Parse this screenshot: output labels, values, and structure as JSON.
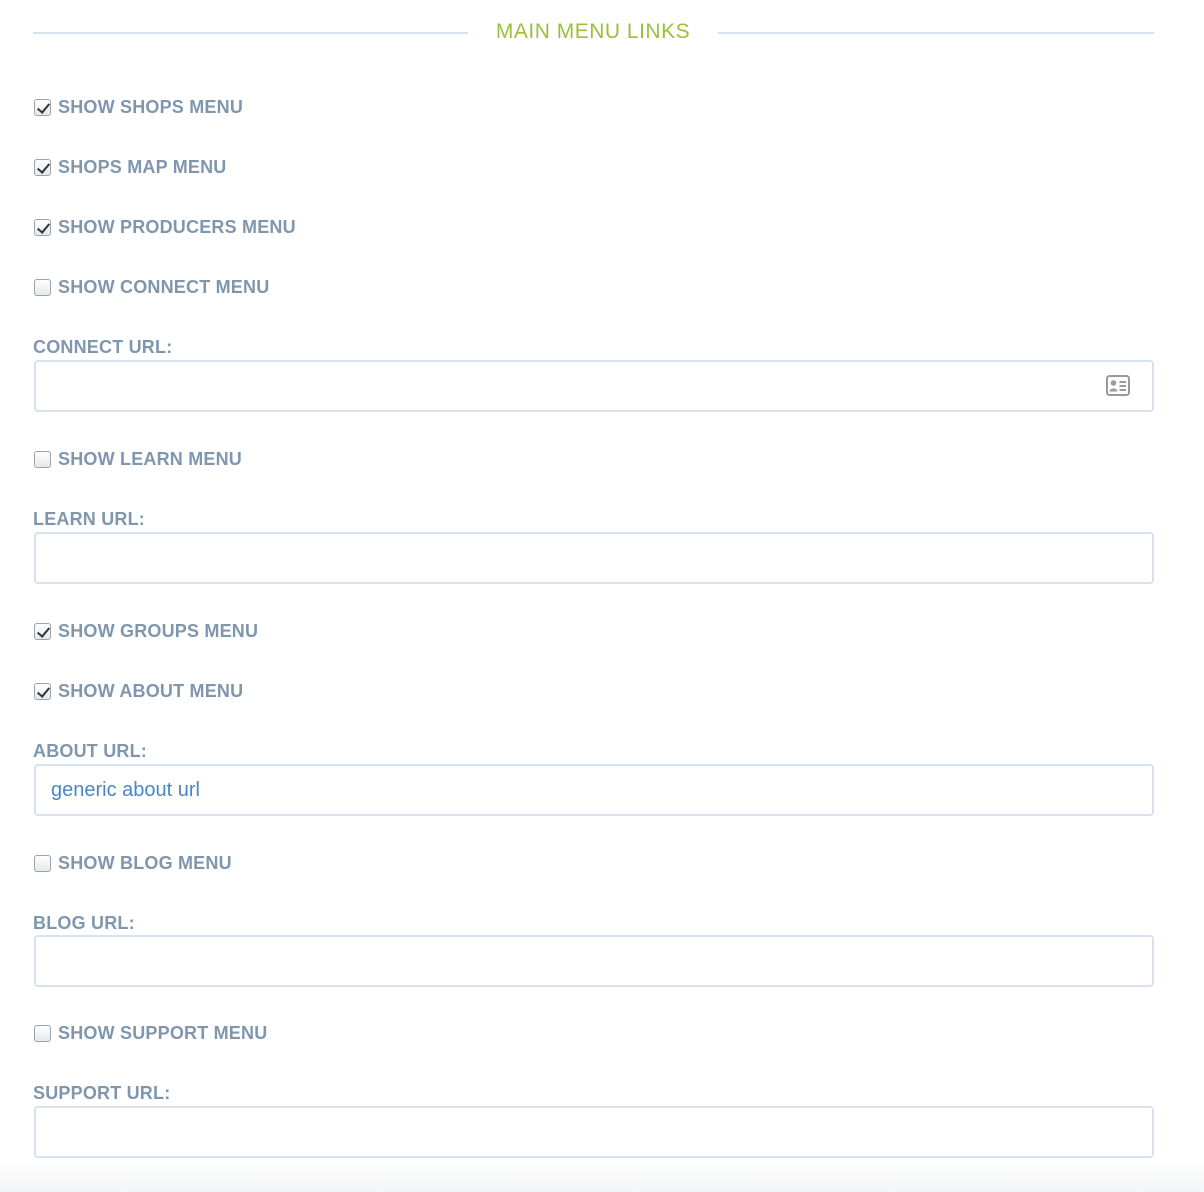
{
  "section": {
    "title": "MAIN MENU LINKS"
  },
  "checkboxes": {
    "show_shops_menu": {
      "label": "SHOW SHOPS MENU",
      "checked": true
    },
    "shops_map_menu": {
      "label": "SHOPS MAP MENU",
      "checked": true
    },
    "show_producers_menu": {
      "label": "SHOW PRODUCERS MENU",
      "checked": true
    },
    "show_connect_menu": {
      "label": "SHOW CONNECT MENU",
      "checked": false
    },
    "show_learn_menu": {
      "label": "SHOW LEARN MENU",
      "checked": false
    },
    "show_groups_menu": {
      "label": "SHOW GROUPS MENU",
      "checked": true
    },
    "show_about_menu": {
      "label": "SHOW ABOUT MENU",
      "checked": true
    },
    "show_blog_menu": {
      "label": "SHOW BLOG MENU",
      "checked": false
    },
    "show_support_menu": {
      "label": "SHOW SUPPORT MENU",
      "checked": false
    }
  },
  "fields": {
    "connect_url": {
      "label": "CONNECT URL:",
      "value": ""
    },
    "learn_url": {
      "label": "LEARN URL:",
      "value": ""
    },
    "about_url": {
      "label": "ABOUT URL:",
      "value": "generic about url"
    },
    "blog_url": {
      "label": "BLOG URL:",
      "value": ""
    },
    "support_url": {
      "label": "SUPPORT URL:",
      "value": ""
    }
  },
  "icons": {
    "connect_field_icon": "contact-card-icon"
  },
  "colors": {
    "title_green": "#9cbf3b",
    "label_gray_blue": "#7f96ad",
    "field_border": "#d6e2ef",
    "input_text_blue": "#4a86c5"
  }
}
